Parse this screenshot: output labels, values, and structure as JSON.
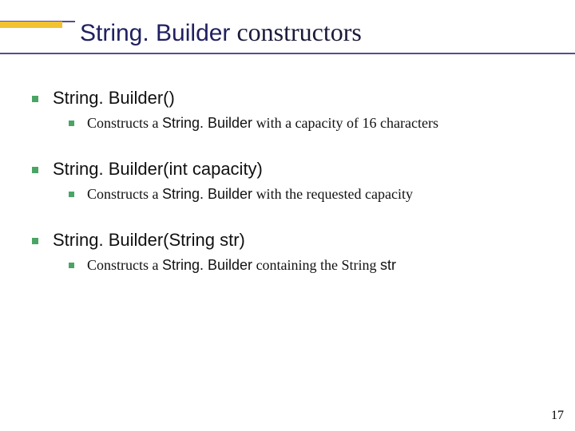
{
  "title": {
    "sans": "String. Builder",
    "serif": " constructors"
  },
  "items": [
    {
      "head": "String. Builder()",
      "desc_pre": "Constructs a ",
      "desc_code": "String. Builder",
      "desc_post": " with a capacity of 16 characters"
    },
    {
      "head": "String. Builder(int capacity)",
      "desc_pre": "Constructs a ",
      "desc_code": "String. Builder",
      "desc_post": " with the requested capacity"
    },
    {
      "head": "String. Builder(String str)",
      "desc_pre": "Constructs a ",
      "desc_code": "String. Builder",
      "desc_post_serif": " containing the String ",
      "desc_post_code": "str"
    }
  ],
  "page_number": "17"
}
